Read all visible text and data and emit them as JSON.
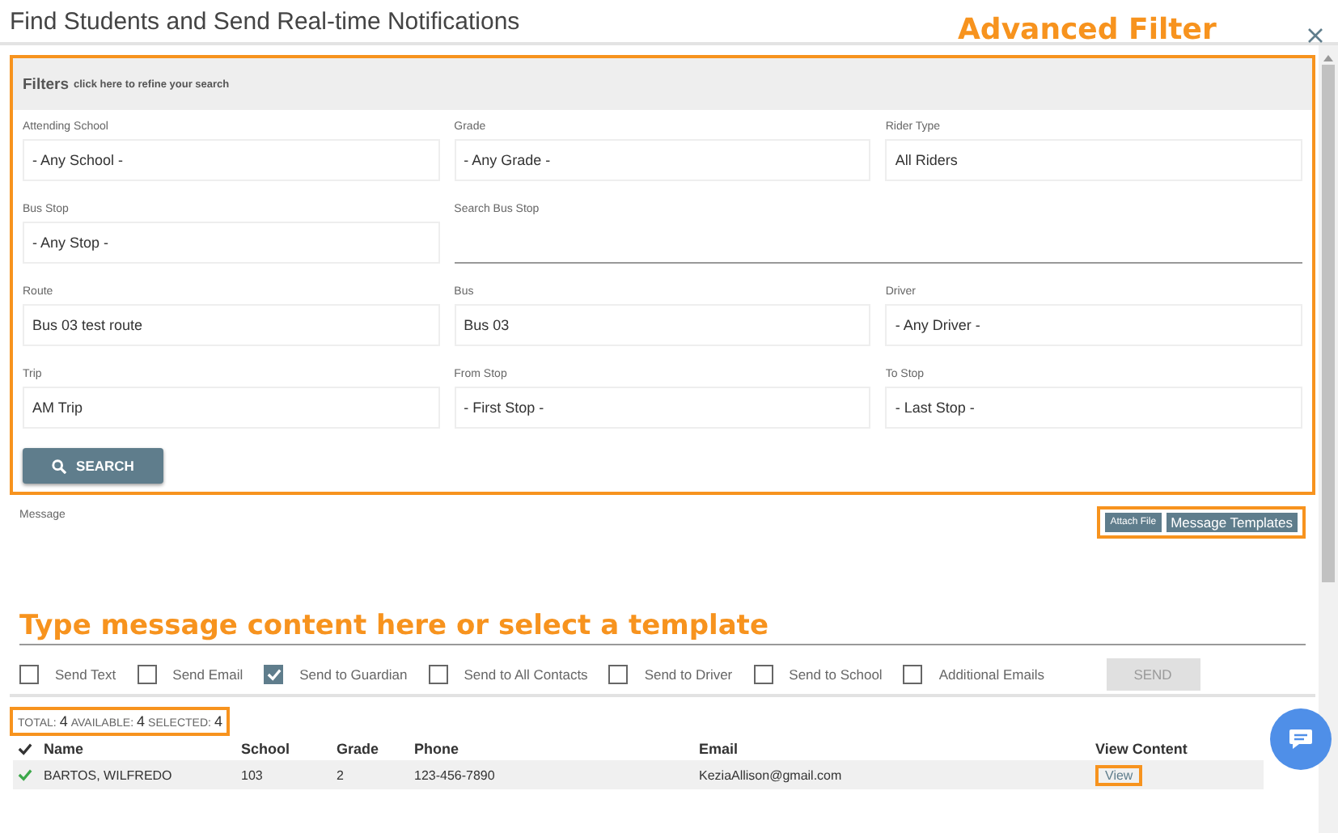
{
  "window": {
    "title": "Find Students and Send Real-time Notifications",
    "annotation": "Advanced Filter"
  },
  "filters": {
    "title": "Filters",
    "hint": "click here to refine your search",
    "highlighted": true,
    "fields": [
      {
        "label": "Attending School",
        "value": "- Any School -",
        "kind": "select"
      },
      {
        "label": "Grade",
        "value": "- Any Grade -",
        "kind": "select"
      },
      {
        "label": "Rider Type",
        "value": "All Riders",
        "kind": "select"
      },
      {
        "label": "Bus Stop",
        "value": "- Any Stop -",
        "kind": "select"
      },
      {
        "label": "Search Bus Stop",
        "kind": "search"
      },
      {
        "label": "Route",
        "value": "Bus 03 test route",
        "kind": "select"
      },
      {
        "label": "Bus",
        "value": "Bus 03",
        "kind": "select"
      },
      {
        "label": "Driver",
        "value": "- Any Driver -",
        "kind": "select"
      },
      {
        "label": "Trip",
        "value": "AM Trip",
        "kind": "select"
      },
      {
        "label": "From Stop",
        "value": "- First Stop -",
        "kind": "select"
      },
      {
        "label": "To Stop",
        "value": "- Last Stop -",
        "kind": "select"
      }
    ],
    "search_button": "SEARCH"
  },
  "message": {
    "label": "Message",
    "attach_button": "Attach File",
    "templates_button": "Message Templates",
    "buttons_highlighted": true,
    "annotation": "Type message content here or select a template",
    "options": [
      {
        "label": "Send Text",
        "checked": false
      },
      {
        "label": "Send Email",
        "checked": false
      },
      {
        "label": "Send to Guardian",
        "checked": true
      },
      {
        "label": "Send to All Contacts",
        "checked": false
      },
      {
        "label": "Send to Driver",
        "checked": false
      },
      {
        "label": "Send to School",
        "checked": false
      },
      {
        "label": "Additional Emails",
        "checked": false
      }
    ],
    "send_button": "SEND",
    "send_disabled": true
  },
  "summary": {
    "total_label": "TOTAL:",
    "total": "4",
    "available_label": "AVAILABLE:",
    "available": "4",
    "selected_label": "SELECTED:",
    "selected": "4",
    "highlighted": true
  },
  "table": {
    "columns": [
      "Name",
      "School",
      "Grade",
      "Phone",
      "Email",
      "View Content"
    ],
    "rows": [
      {
        "checked": true,
        "selected": true,
        "cells": [
          "BARTOS, WILFREDO",
          "103",
          "2",
          "123-456-7890",
          "KeziaAllison@gmail.com"
        ],
        "view": "View",
        "view_highlighted": true
      }
    ]
  }
}
